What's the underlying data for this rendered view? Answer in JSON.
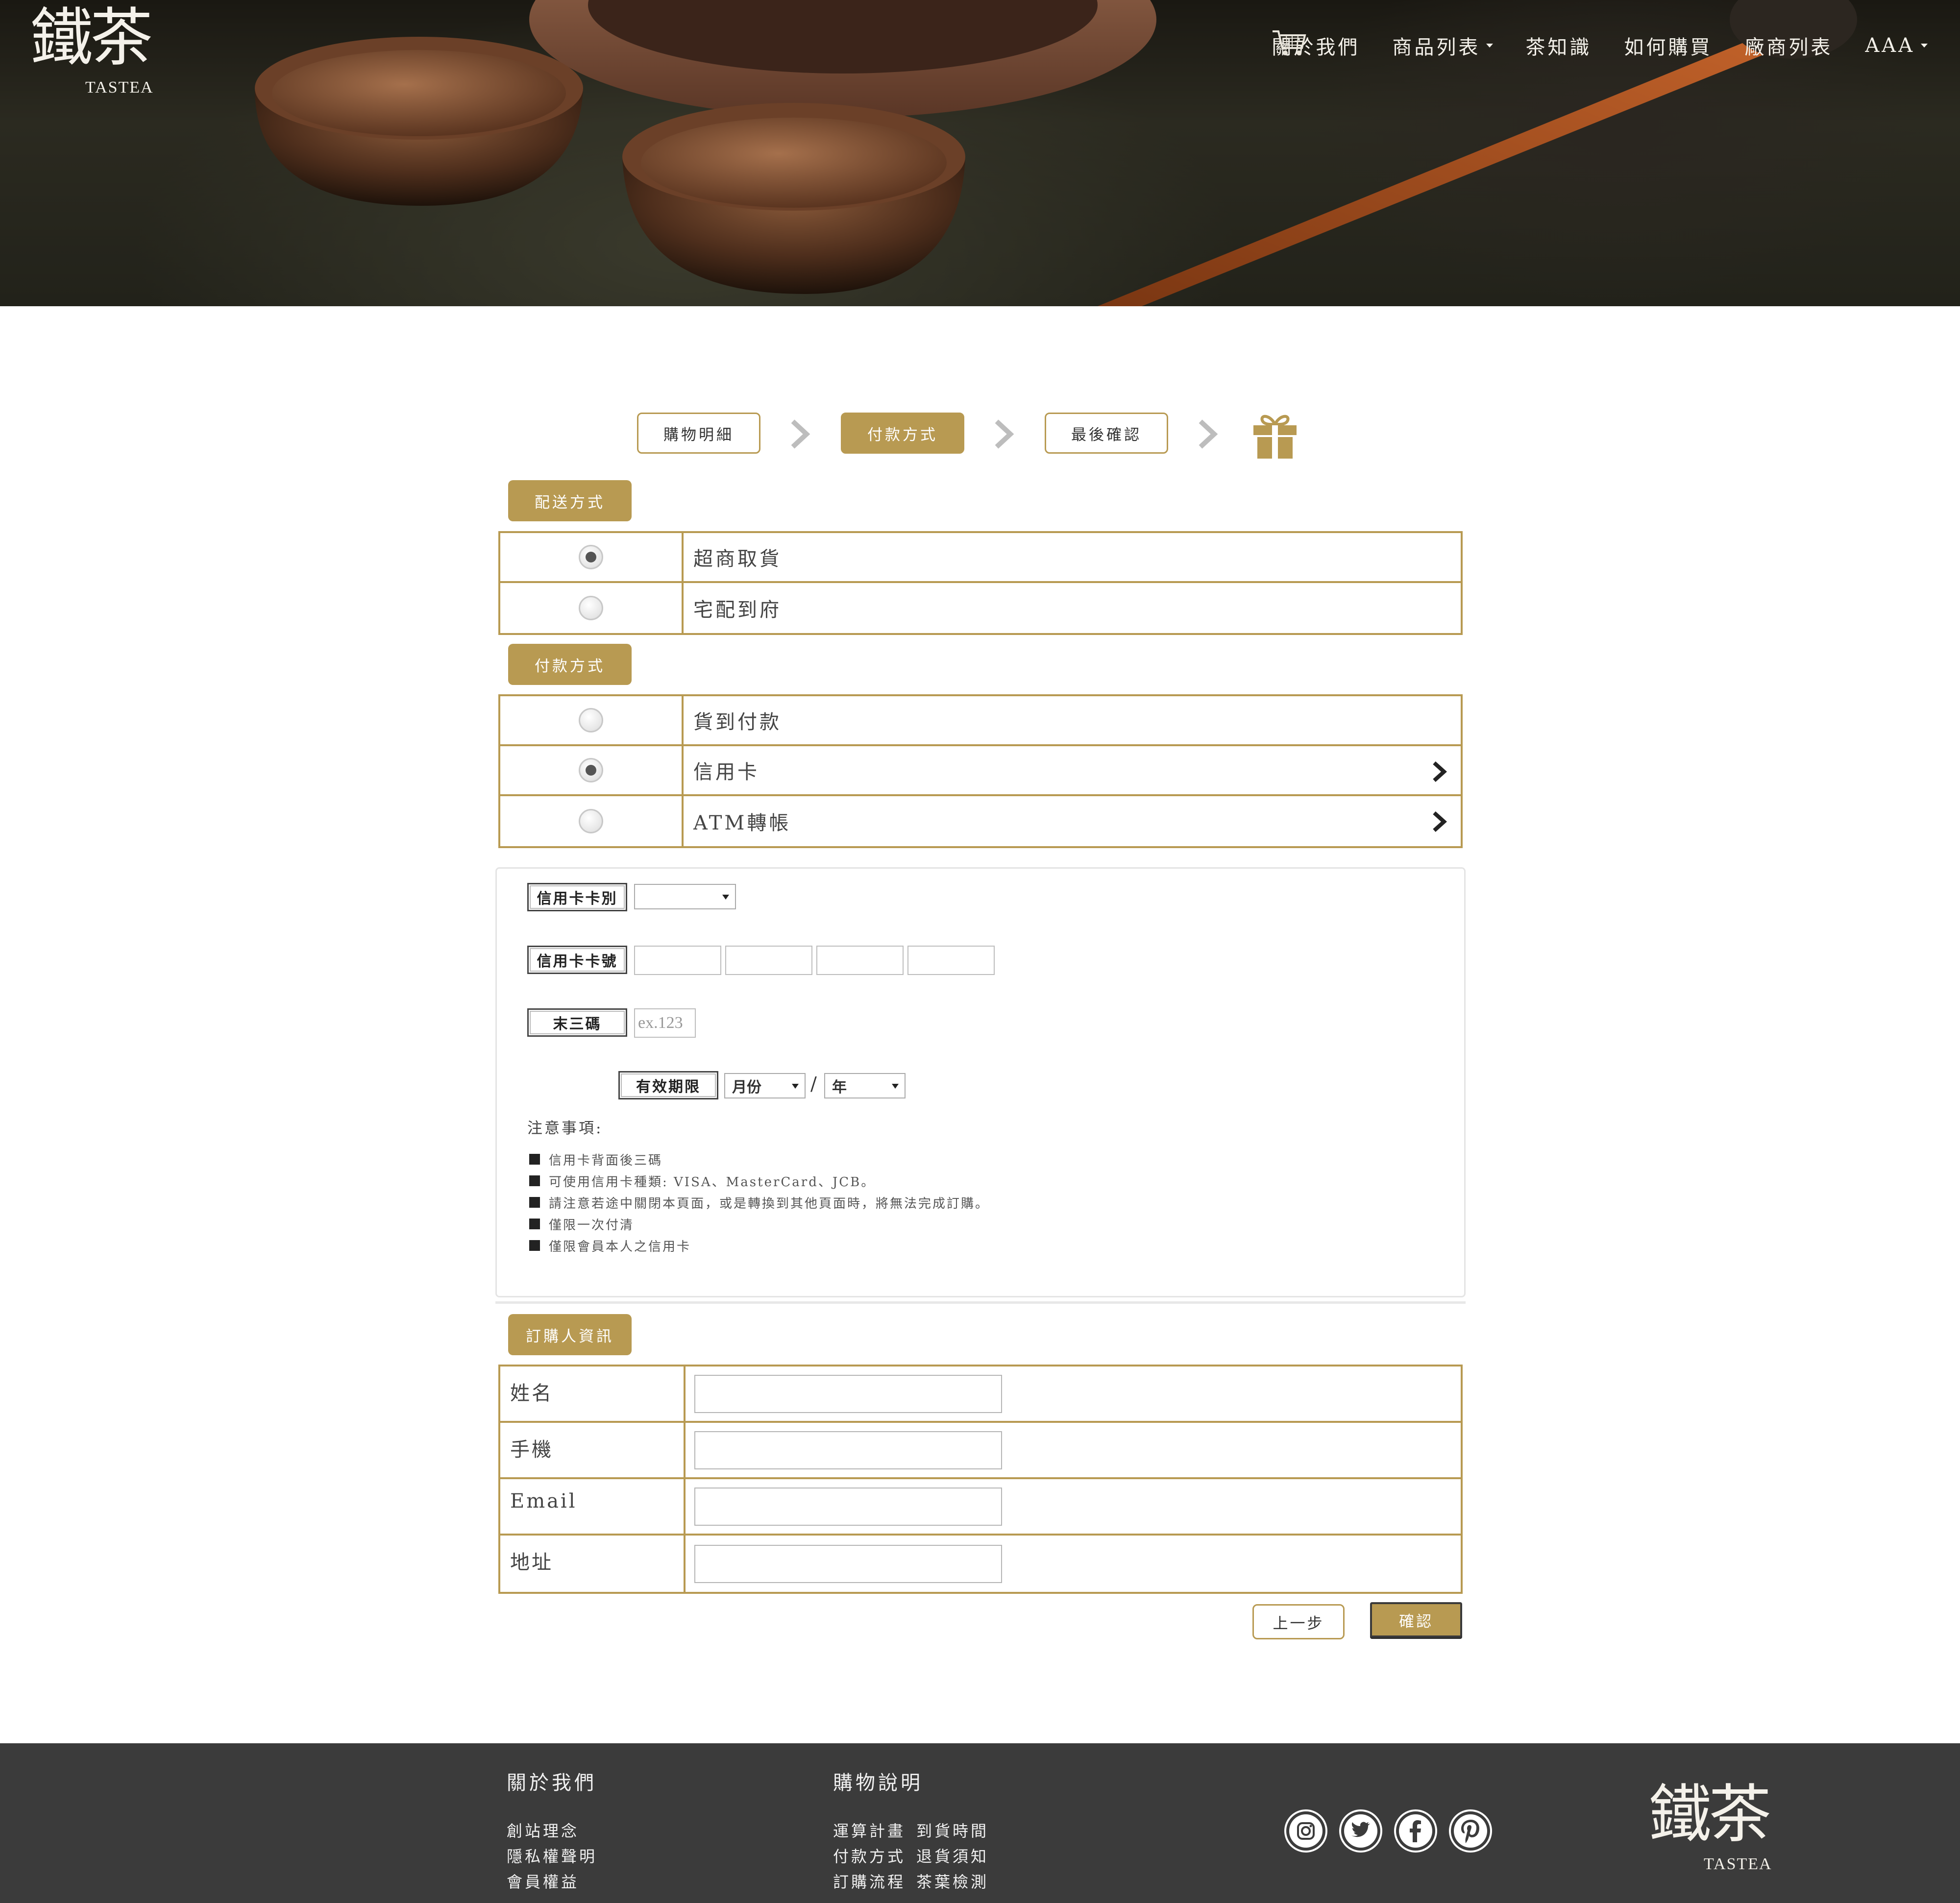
{
  "brand": {
    "kanji": "鐵茶",
    "latin": "TASTEA"
  },
  "nav": {
    "items": [
      {
        "label": "關於我們",
        "dropdown": false
      },
      {
        "label": "商品列表",
        "dropdown": true
      },
      {
        "label": "茶知識",
        "dropdown": false
      },
      {
        "label": "如何購買",
        "dropdown": false
      },
      {
        "label": "廠商列表",
        "dropdown": false
      },
      {
        "label": "AAA",
        "dropdown": true
      }
    ],
    "cart_icon": "shopping-cart-icon"
  },
  "steps": {
    "items": [
      "購物明細",
      "付款方式",
      "最後確認"
    ],
    "active_index": 1,
    "final_icon": "gift-icon"
  },
  "shipping": {
    "title": "配送方式",
    "options": [
      {
        "label": "超商取貨",
        "selected": true
      },
      {
        "label": "宅配到府",
        "selected": false
      }
    ]
  },
  "payment": {
    "title": "付款方式",
    "options": [
      {
        "label": "貨到付款",
        "selected": false,
        "has_arrow": false
      },
      {
        "label": "信用卡",
        "selected": true,
        "has_arrow": true
      },
      {
        "label": "ATM轉帳",
        "selected": false,
        "has_arrow": true
      }
    ]
  },
  "credit_card": {
    "type_label": "信用卡卡別",
    "type_value": "",
    "number_label": "信用卡卡號",
    "cvv_label": "末三碼",
    "cvv_placeholder": "ex.123",
    "expiry_label": "有效期限",
    "month_value": "月份",
    "separator": "/",
    "year_value": "年",
    "notes_title": "注意事項:",
    "notes": [
      "信用卡背面後三碼",
      "可使用信用卡種類: VISA、MasterCard、JCB。",
      "請注意若途中關閉本頁面，或是轉換到其他頁面時，將無法完成訂購。",
      "僅限一次付清",
      "僅限會員本人之信用卡"
    ]
  },
  "buyer": {
    "title": "訂購人資訊",
    "fields": [
      {
        "label": "姓名",
        "value": ""
      },
      {
        "label": "手機",
        "value": ""
      },
      {
        "label": "Email",
        "value": ""
      },
      {
        "label": "地址",
        "value": ""
      }
    ]
  },
  "actions": {
    "back": "上一步",
    "confirm": "確認"
  },
  "footer": {
    "col1": {
      "title": "關於我們",
      "links": [
        "創站理念",
        "隱私權聲明",
        "會員權益"
      ]
    },
    "col2": {
      "title": "購物說明",
      "links": [
        "運算計畫",
        "到貨時間",
        "付款方式",
        "退貨須知",
        "訂購流程",
        "茶葉檢測"
      ]
    },
    "social": [
      "instagram-icon",
      "twitter-icon",
      "facebook-icon",
      "pinterest-icon"
    ]
  },
  "colors": {
    "gold": "#b89a52",
    "footer_bg": "#3b3b3b",
    "text": "#333333"
  }
}
